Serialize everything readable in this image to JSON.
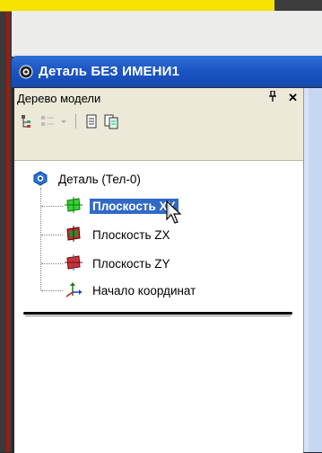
{
  "window": {
    "title": "Деталь БЕЗ ИМЕНИ1"
  },
  "panel": {
    "title": "Дерево модели",
    "pin_label": "ф",
    "close_label": "✕"
  },
  "toolbar": {
    "icons": [
      "tree-structure-icon",
      "filter-icon",
      "dropdown-icon",
      "document-icon",
      "copy-document-icon"
    ]
  },
  "tree": {
    "root_label": "Деталь (Тел-0)",
    "items": [
      {
        "label": "Плоскость XY",
        "selected": true,
        "icon": "plane-green-icon"
      },
      {
        "label": "Плоскость ZX",
        "selected": false,
        "icon": "plane-red-green-icon"
      },
      {
        "label": "Плоскость ZY",
        "selected": false,
        "icon": "plane-red-icon"
      },
      {
        "label": "Начало координат",
        "selected": false,
        "icon": "origin-axes-icon"
      }
    ]
  },
  "colors": {
    "title_bar": "#1c56c4",
    "selection": "#316ac5",
    "panel_bg": "#ece9d8",
    "accent_yellow": "#f6e400",
    "accent_red": "#a01a12"
  }
}
